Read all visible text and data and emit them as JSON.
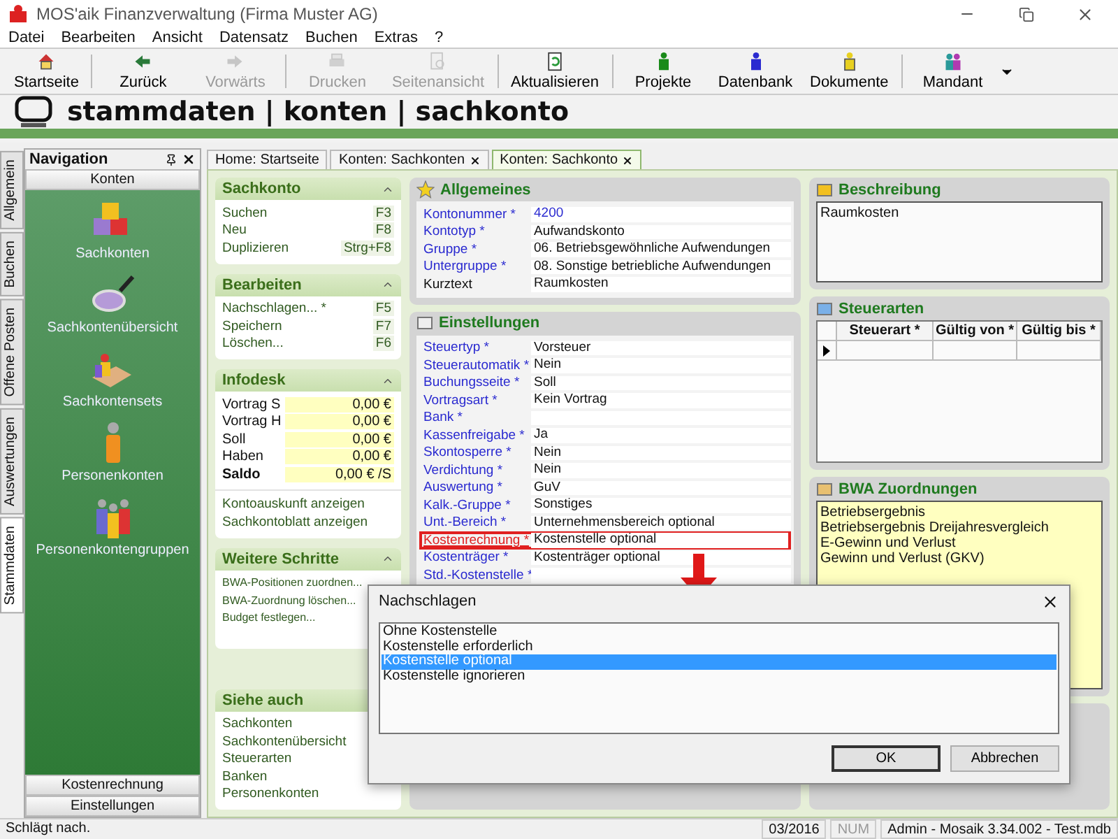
{
  "window": {
    "title": "MOS'aik Finanzverwaltung (Firma Muster AG)"
  },
  "menu": [
    "Datei",
    "Bearbeiten",
    "Ansicht",
    "Datensatz",
    "Buchen",
    "Extras",
    "?"
  ],
  "toolbar": {
    "groups": [
      [
        {
          "label": "Startseite",
          "disabled": false
        }
      ],
      [
        {
          "label": "Zurück",
          "disabled": false
        },
        {
          "label": "Vorwärts",
          "disabled": true
        }
      ],
      [
        {
          "label": "Drucken",
          "disabled": true
        },
        {
          "label": "Seitenansicht",
          "disabled": true
        }
      ],
      [
        {
          "label": "Aktualisieren",
          "disabled": false
        }
      ],
      [
        {
          "label": "Projekte",
          "disabled": false
        },
        {
          "label": "Datenbank",
          "disabled": false
        },
        {
          "label": "Dokumente",
          "disabled": false
        }
      ],
      [
        {
          "label": "Mandant",
          "disabled": false
        }
      ]
    ]
  },
  "breadcrumb": "stammdaten | konten | sachkonto",
  "side_tabs": [
    {
      "label": "Allgemein",
      "selected": false
    },
    {
      "label": "Buchen",
      "selected": false
    },
    {
      "label": "Offene Posten",
      "selected": false
    },
    {
      "label": "Auswertungen",
      "selected": false
    },
    {
      "label": "Stammdaten",
      "selected": true
    }
  ],
  "navigation": {
    "title": "Navigation",
    "group": "Konten",
    "items": [
      "Sachkonten",
      "Sachkontenübersicht",
      "Sachkontensets",
      "Personenkonten",
      "Personenkontengruppen"
    ],
    "bottom_groups": [
      "Kostenrechnung",
      "Einstellungen"
    ]
  },
  "doc_tabs": [
    {
      "label": "Home: Startseite",
      "closable": false,
      "selected": false
    },
    {
      "label": "Konten: Sachkonten",
      "closable": true,
      "selected": false
    },
    {
      "label": "Konten: Sachkonto",
      "closable": true,
      "selected": true
    }
  ],
  "tasks": [
    {
      "title": "Sachkonto",
      "kind": "actions",
      "items": [
        {
          "label": "Suchen",
          "shortcut": "F3"
        },
        {
          "label": "Neu",
          "shortcut": "F8"
        },
        {
          "label": "Duplizieren",
          "shortcut": "Strg+F8"
        }
      ]
    },
    {
      "title": "Bearbeiten",
      "kind": "actions",
      "items": [
        {
          "label": "Nachschlagen... *",
          "shortcut": "F5"
        },
        {
          "label": "Speichern",
          "shortcut": "F7"
        },
        {
          "label": "Löschen...",
          "shortcut": "F6"
        }
      ]
    },
    {
      "title": "Infodesk",
      "kind": "infodesk",
      "items": [
        {
          "label": "Vortrag S",
          "value": "0,00 €",
          "bold": false
        },
        {
          "label": "Vortrag H",
          "value": "0,00 €",
          "bold": false
        },
        {
          "label": "Soll",
          "value": "0,00 €",
          "bold": false
        },
        {
          "label": "Haben",
          "value": "0,00 €",
          "bold": false
        },
        {
          "label": "Saldo",
          "value": "0,00 € /S",
          "bold": true
        }
      ],
      "links": [
        "Kontoauskunft anzeigen",
        "Sachkontoblatt anzeigen"
      ]
    },
    {
      "title": "Weitere Schritte",
      "kind": "actions",
      "items": [
        {
          "label": "BWA-Positionen zuordnen..."
        },
        {
          "label": "BWA-Zuordnung löschen..."
        },
        {
          "label": "Budget festlegen..."
        }
      ]
    },
    {
      "title": "Siehe auch",
      "kind": "links",
      "items": [
        {
          "label": "Sachkonten"
        },
        {
          "label": "Sachkontenübersicht"
        },
        {
          "label": "Steuerarten"
        },
        {
          "label": "Banken"
        },
        {
          "label": "Personenkonten"
        }
      ]
    }
  ],
  "allgemeines": {
    "title": "Allgemeines",
    "fields": [
      {
        "label": "Kontonummer *",
        "value": "4200",
        "required": true,
        "highlighted": false
      },
      {
        "label": "Kontotyp *",
        "value": "Aufwandskonto",
        "required": true,
        "highlighted": false
      },
      {
        "label": "Gruppe *",
        "value": "06. Betriebsgewöhnliche Aufwendungen",
        "required": true,
        "highlighted": false
      },
      {
        "label": "Untergruppe *",
        "value": "08. Sonstige betriebliche Aufwendungen",
        "required": true,
        "highlighted": false
      },
      {
        "label": "Kurztext",
        "value": "Raumkosten",
        "required": false,
        "highlighted": false
      }
    ]
  },
  "einstellungen": {
    "title": "Einstellungen",
    "fields": [
      {
        "label": "Steuertyp *",
        "value": "Vorsteuer",
        "required": true,
        "highlighted": false
      },
      {
        "label": "Steuerautomatik *",
        "value": "Nein",
        "required": true,
        "highlighted": false
      },
      {
        "label": "Buchungsseite *",
        "value": "Soll",
        "required": true,
        "highlighted": false
      },
      {
        "label": "Vortragsart *",
        "value": "Kein Vortrag",
        "required": true,
        "highlighted": false
      },
      {
        "label": "Bank *",
        "required": true,
        "highlighted": false
      },
      {
        "label": "Kassenfreigabe *",
        "value": "Ja",
        "required": true,
        "highlighted": false
      },
      {
        "label": "Skontosperre *",
        "value": "Nein",
        "required": true,
        "highlighted": false
      },
      {
        "label": "Verdichtung *",
        "value": "Nein",
        "required": true,
        "highlighted": false
      },
      {
        "label": "Auswertung *",
        "value": "GuV",
        "required": true,
        "highlighted": false
      },
      {
        "label": "Kalk.-Gruppe *",
        "value": "Sonstiges",
        "required": true,
        "highlighted": false
      },
      {
        "label": "Unt.-Bereich *",
        "value": "Unternehmensbereich optional",
        "required": true,
        "highlighted": false
      },
      {
        "label": "Kostenrechnung *",
        "value": "Kostenstelle optional",
        "required": true,
        "highlighted": true
      },
      {
        "label": "Kostenträger *",
        "value": "Kostenträger optional",
        "required": true,
        "highlighted": false
      },
      {
        "label": "Std.-Kostenstelle *",
        "required": true,
        "highlighted": false
      }
    ]
  },
  "beschreibung": {
    "title": "Beschreibung",
    "text": "Raumkosten"
  },
  "steuerarten": {
    "title": "Steuerarten",
    "columns": [
      "Steuerart *",
      "Gültig von *",
      "Gültig bis *"
    ],
    "rows": [
      {
        "current": true
      }
    ]
  },
  "bwa": {
    "title": "BWA Zuordnungen",
    "items": [
      "Betriebsergebnis",
      "Betriebsergebnis Dreijahresvergleich",
      "E-Gewinn und Verlust",
      "Gewinn und Verlust (GKV)"
    ]
  },
  "dialog": {
    "title": "Nachschlagen",
    "options": [
      {
        "label": "Ohne Kostenstelle",
        "selected": false
      },
      {
        "label": "Kostenstelle erforderlich",
        "selected": false
      },
      {
        "label": "Kostenstelle optional",
        "selected": true
      },
      {
        "label": "Kostenstelle ignorieren",
        "selected": false
      }
    ],
    "buttons": [
      {
        "label": "OK",
        "default": true
      },
      {
        "label": "Abbrechen",
        "default": false
      }
    ]
  },
  "status_bar": [
    {
      "text": "Schlägt nach.",
      "disabled": false
    },
    {
      "text": "03/2016",
      "disabled": false
    },
    {
      "text": "NUM",
      "disabled": true
    },
    {
      "text": "Admin - Mosaik 3.34.002 - Test.mdb",
      "disabled": false
    }
  ]
}
